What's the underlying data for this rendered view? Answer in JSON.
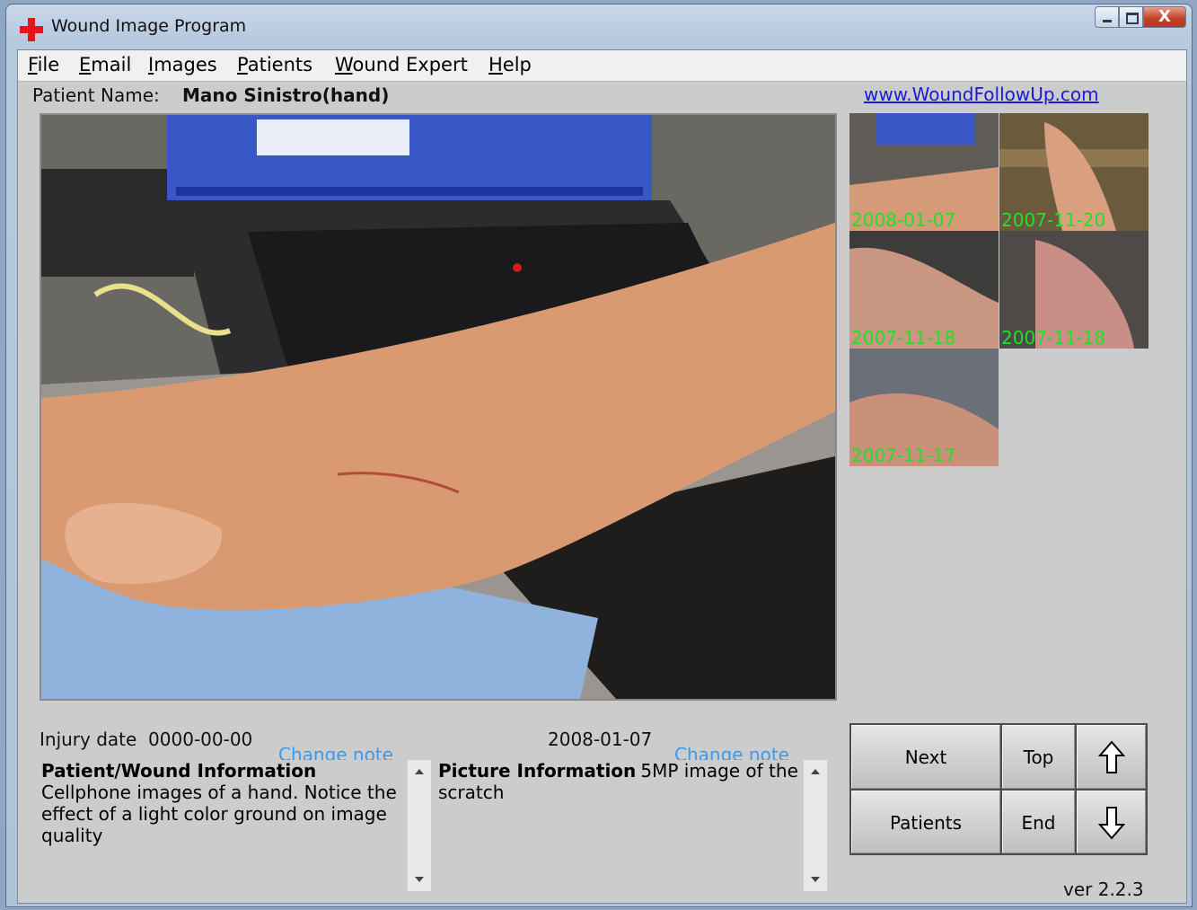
{
  "window": {
    "title": "Wound Image Program",
    "close_glyph": "X"
  },
  "menu": [
    {
      "label": "File",
      "ul": "F",
      "rest": "ile"
    },
    {
      "label": "Email",
      "ul": "E",
      "rest": "mail"
    },
    {
      "label": "Images",
      "ul": "I",
      "rest": "mages"
    },
    {
      "label": "Patients",
      "ul": "P",
      "rest": "atients"
    },
    {
      "label": "Wound Expert",
      "ul": "W",
      "rest": "ound Expert"
    },
    {
      "label": "Help",
      "ul": "H",
      "rest": "elp"
    }
  ],
  "patient": {
    "label": "Patient Name:",
    "name": "Mano Sinistro(hand)"
  },
  "link": "www.WoundFollowUp.com",
  "thumbnails": [
    {
      "date": "2008-01-07"
    },
    {
      "date": "2007-11-20"
    },
    {
      "date": "2007-11-18"
    },
    {
      "date": "2007-11-18"
    },
    {
      "date": "2007-11-17"
    }
  ],
  "injury": {
    "label": "Injury date",
    "date": "0000-00-00"
  },
  "picture_date": "2008-01-07",
  "patient_note": {
    "change_label": "Change note",
    "heading": "Patient/Wound Information",
    "text": "Cellphone images of a hand. Notice the effect of a light color ground on image quality"
  },
  "picture_note": {
    "change_label": "Change note",
    "heading": "Picture Information",
    "text": "5MP image of the scratch"
  },
  "buttons": {
    "next": "Next",
    "top": "Top",
    "patients": "Patients",
    "end": "End",
    "up_icon": "up-arrow-icon",
    "down_icon": "down-arrow-icon"
  },
  "version": "ver 2.2.3",
  "colors": {
    "thumb_date": "#22e02a",
    "change_note": "#3c9ae8",
    "link": "#1a1adb",
    "client_bg": "#cccccc"
  }
}
